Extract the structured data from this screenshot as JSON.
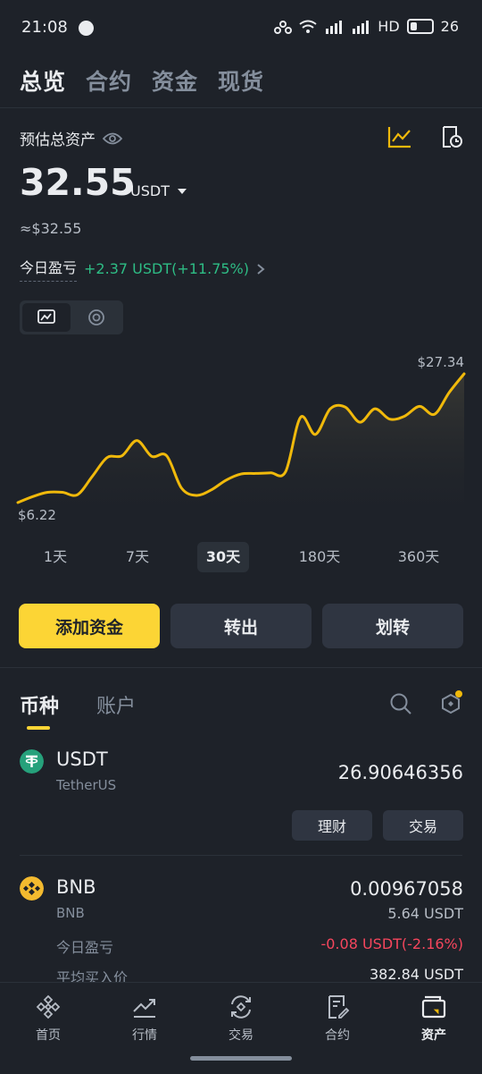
{
  "status_bar": {
    "time": "21:08",
    "network": "HD",
    "battery": "26"
  },
  "top_tabs": [
    {
      "label": "总览",
      "active": true
    },
    {
      "label": "合约",
      "active": false
    },
    {
      "label": "资金",
      "active": false
    },
    {
      "label": "现货",
      "active": false
    }
  ],
  "overview": {
    "estimated_label": "预估总资产",
    "balance": "32.55",
    "unit": "USDT",
    "approx": "≈$32.55",
    "pnl_label": "今日盈亏",
    "pnl_value": "+2.37 USDT(+11.75%)"
  },
  "chart": {
    "max_label": "$27.34",
    "min_label": "$6.22",
    "line_color": "#f0b90b"
  },
  "chart_data": {
    "type": "line",
    "x": [
      0,
      1,
      2,
      3,
      4,
      5,
      6,
      7,
      8,
      9,
      10,
      11,
      12,
      13,
      14,
      15,
      16,
      17,
      18,
      19,
      20,
      21,
      22,
      23,
      24,
      25,
      26,
      27,
      28,
      29,
      30
    ],
    "values": [
      6.22,
      7.2,
      7.9,
      7.9,
      7.5,
      10.5,
      13.6,
      13.9,
      16.4,
      13.8,
      13.9,
      8.6,
      7.4,
      8.3,
      9.9,
      10.9,
      11.0,
      11.1,
      11.3,
      20.2,
      17.4,
      21.6,
      21.9,
      19.4,
      21.6,
      19.9,
      20.4,
      22.0,
      20.7,
      24.3,
      27.34
    ],
    "ylim": [
      6.22,
      27.34
    ]
  },
  "ranges": [
    {
      "label": "1天",
      "active": false
    },
    {
      "label": "7天",
      "active": false
    },
    {
      "label": "30天",
      "active": true
    },
    {
      "label": "180天",
      "active": false
    },
    {
      "label": "360天",
      "active": false
    }
  ],
  "actions": {
    "add": "添加资金",
    "withdraw": "转出",
    "transfer": "划转"
  },
  "section_tabs": {
    "coins": "币种",
    "accounts": "账户"
  },
  "coins": [
    {
      "symbol": "USDT",
      "name": "TetherUS",
      "amount": "26.90646356",
      "buttons": [
        "理财",
        "交易"
      ],
      "icon_color": "#26a17b"
    },
    {
      "symbol": "BNB",
      "name": "BNB",
      "amount": "0.00967058",
      "usd_value": "5.64 USDT",
      "pnl_label": "今日盈亏",
      "pnl_value": "-0.08 USDT(-2.16%)",
      "avg_label": "平均买入价",
      "avg_value": "382.84 USDT",
      "icon_color": "#f3ba2f"
    }
  ],
  "nav": [
    {
      "label": "首页",
      "icon": "home-icon"
    },
    {
      "label": "行情",
      "icon": "markets-icon"
    },
    {
      "label": "交易",
      "icon": "trade-icon"
    },
    {
      "label": "合约",
      "icon": "futures-icon"
    },
    {
      "label": "资产",
      "icon": "wallet-icon",
      "active": true
    }
  ],
  "colors": {
    "accent": "#fcd535",
    "positive": "#2ebd85",
    "negative": "#f6465d"
  }
}
